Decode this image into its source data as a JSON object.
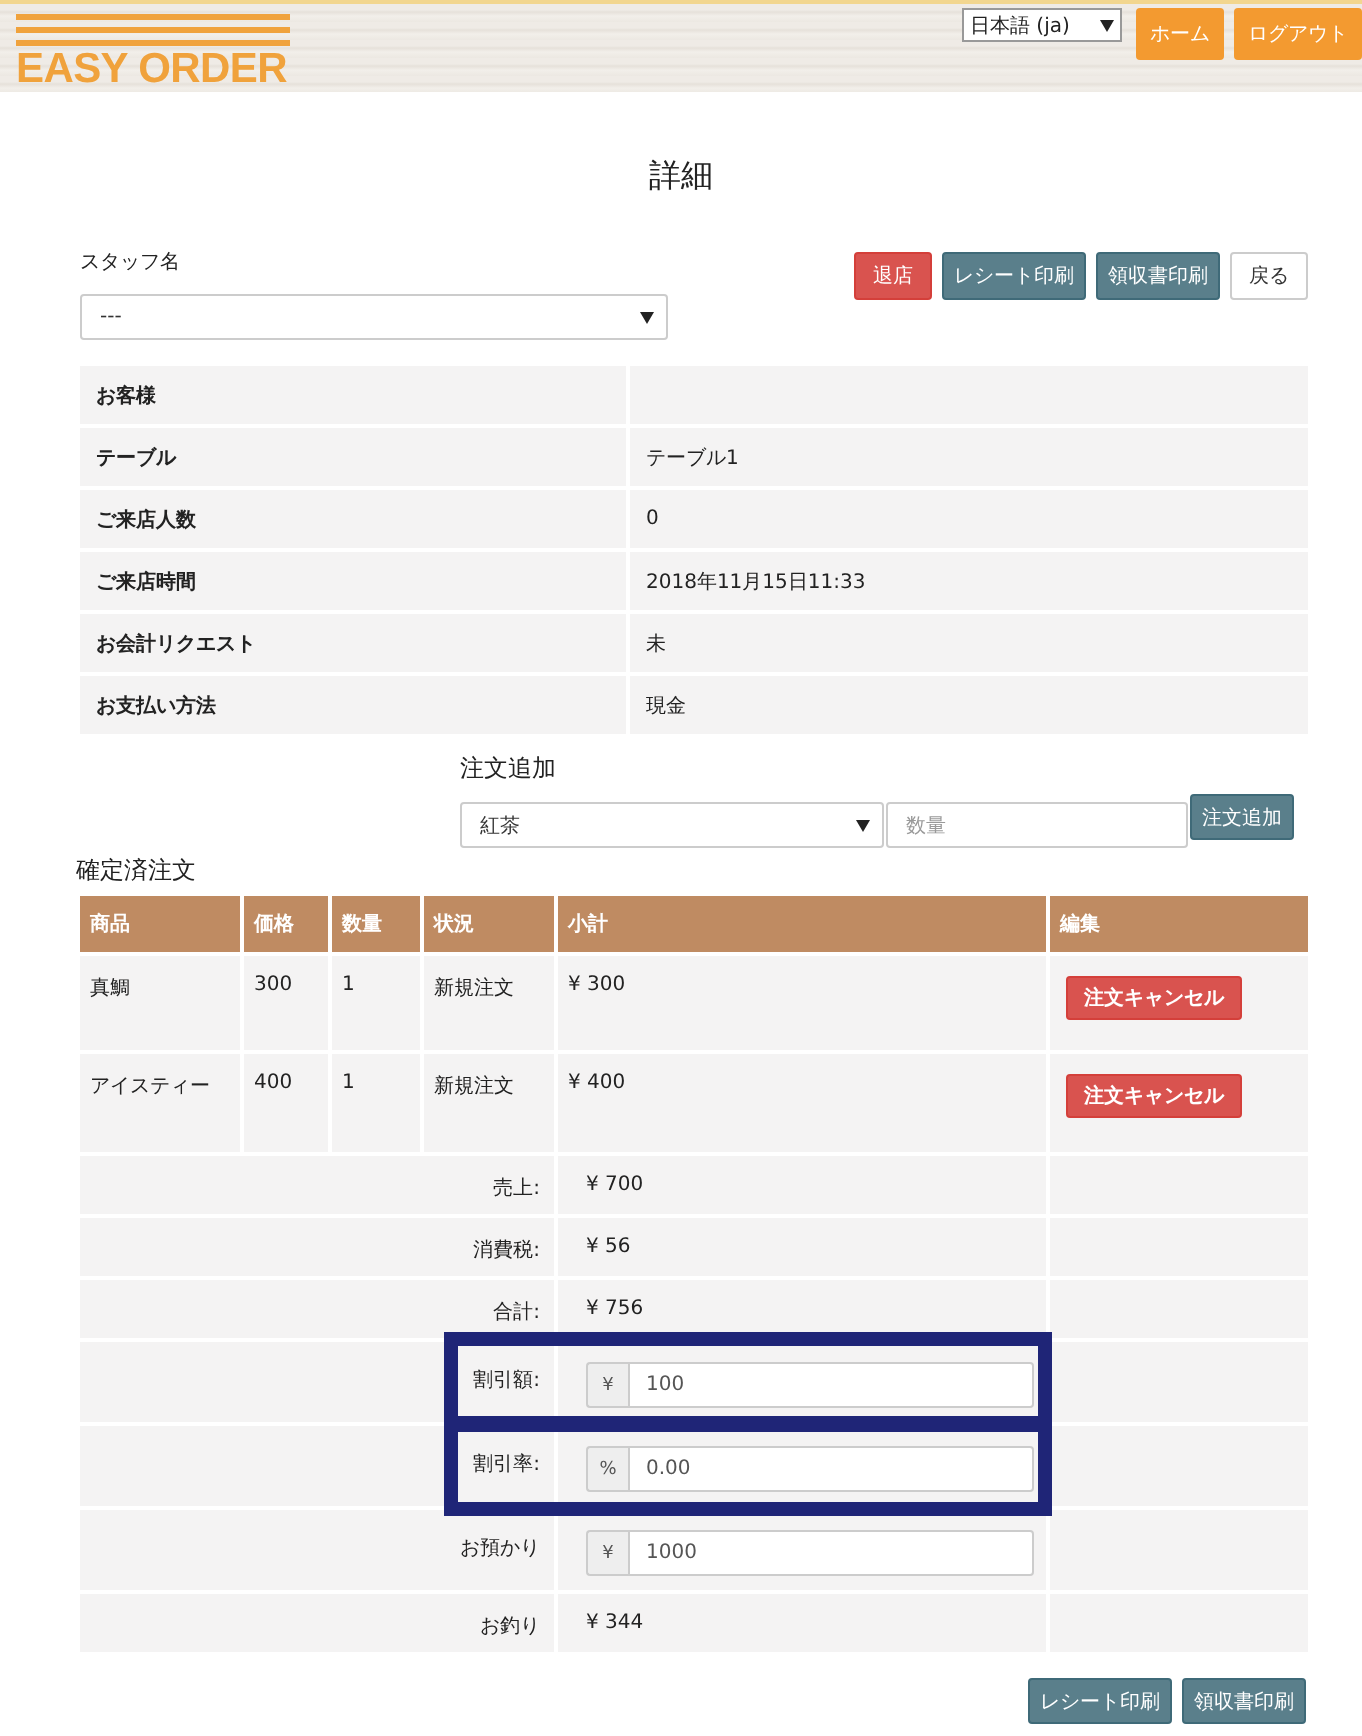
{
  "header": {
    "logo": "EASY ORDER",
    "language": "日本語 (ja)",
    "nav_buttons": [
      "ホーム",
      "ログアウト"
    ]
  },
  "title": "詳細",
  "staff": {
    "label": "スタッフ名",
    "value": "---"
  },
  "actions": [
    {
      "label": "退店",
      "kind": "danger"
    },
    {
      "label": "レシート印刷",
      "kind": "primary"
    },
    {
      "label": "領収書印刷",
      "kind": "primary"
    },
    {
      "label": "戻る",
      "kind": "default"
    }
  ],
  "info_table": [
    {
      "label": "お客様"
    },
    {
      "label": "テーブル",
      "value": "テーブル1"
    },
    {
      "label": "ご来店人数",
      "value": "0"
    },
    {
      "label": "ご来店時間",
      "value": "2018年11月15日11:33"
    },
    {
      "label": "お会計リクエスト",
      "value": "未"
    },
    {
      "label": "お支払い方法",
      "value": "現金"
    }
  ],
  "add_order": {
    "heading": "注文追加",
    "product": "紅茶",
    "quantity": {
      "placeholder": "数量"
    },
    "button": "注文追加"
  },
  "confirmed_orders": {
    "heading": "確定済注文",
    "columns": [
      "商品",
      "価格",
      "数量",
      "状況",
      "小計",
      "編集"
    ],
    "rows": [
      {
        "cells": [
          "真鯛",
          "300",
          "1",
          "新規注文",
          "¥ 300"
        ],
        "action": "注文キャンセル"
      },
      {
        "cells": [
          "アイスティー",
          "400",
          "1",
          "新規注文",
          "¥ 400"
        ],
        "action": "注文キャンセル"
      }
    ],
    "summary": [
      {
        "kind": "text",
        "label": "売上:",
        "value": "¥ 700",
        "highlighted": false
      },
      {
        "kind": "text",
        "label": "消費税:",
        "value": "¥ 56",
        "highlighted": false
      },
      {
        "kind": "text",
        "label": "合計:",
        "value": "¥ 756",
        "highlighted": false
      },
      {
        "kind": "input",
        "label": "割引額:",
        "prefix": "¥",
        "value": "100",
        "highlighted": true
      },
      {
        "kind": "input",
        "label": "割引率:",
        "prefix": "%",
        "value": "0.00",
        "highlighted": true
      },
      {
        "kind": "input",
        "label": "お預かり",
        "prefix": "¥",
        "value": "1000",
        "highlighted": false
      },
      {
        "kind": "text",
        "label": "お釣り",
        "value": "¥ 344",
        "highlighted": false
      }
    ]
  },
  "footer_buttons": [
    {
      "label": "レシート印刷",
      "kind": "primary"
    },
    {
      "label": "領収書印刷",
      "kind": "primary"
    }
  ]
}
